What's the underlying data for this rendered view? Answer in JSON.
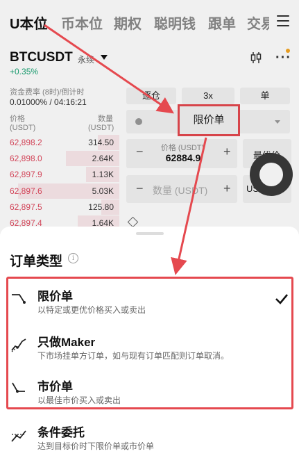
{
  "tabs": [
    "U本位",
    "币本位",
    "期权",
    "聪明钱",
    "跟单",
    "交易"
  ],
  "symbol": {
    "name": "BTCUSDT",
    "type": "永续",
    "change": "+0.35%"
  },
  "funding": {
    "label": "资金费率 (8时)/倒计时",
    "value": "0.01000% / 04:16:21"
  },
  "orderbook": {
    "price_label": "价格",
    "price_unit": "(USDT)",
    "qty_label": "数量",
    "qty_unit": "(USDT)",
    "rows": [
      {
        "price": "62,898.2",
        "qty": "314.50",
        "depth": 0.18
      },
      {
        "price": "62,898.0",
        "qty": "2.64K",
        "depth": 0.45
      },
      {
        "price": "62,897.9",
        "qty": "1.13K",
        "depth": 0.28
      },
      {
        "price": "62,897.6",
        "qty": "5.03K",
        "depth": 0.85
      },
      {
        "price": "62,897.5",
        "qty": "125.80",
        "depth": 0.15
      },
      {
        "price": "62,897.4",
        "qty": "1.64K",
        "depth": 0.35
      }
    ]
  },
  "form": {
    "margin_mode": "逐仓",
    "leverage": "3x",
    "position_mode": "单",
    "order_type": "限价单",
    "price_label": "价格 (USDT)",
    "price_value": "62884.9",
    "best_price": "最优价",
    "qty_placeholder": "数量 (USDT)",
    "qty_unit": "USDT"
  },
  "sheet": {
    "title": "订单类型",
    "info_glyph": "i",
    "options": [
      {
        "title": "限价单",
        "desc": "以特定或更优价格买入或卖出",
        "selected": true,
        "icon": "limit-order-icon"
      },
      {
        "title": "只做Maker",
        "desc": "下市场挂单方订单，如与现有订单匹配则订单取消。",
        "selected": false,
        "icon": "maker-only-icon"
      },
      {
        "title": "市价单",
        "desc": "以最佳市价买入或卖出",
        "selected": false,
        "icon": "market-order-icon"
      },
      {
        "title": "条件委托",
        "desc": "达到目标价时下限价单或市价单",
        "selected": false,
        "icon": "conditional-order-icon"
      }
    ]
  },
  "colors": {
    "accent_red": "#e5494f",
    "ask_red": "#e04a5f",
    "up_green": "#1aa474"
  }
}
